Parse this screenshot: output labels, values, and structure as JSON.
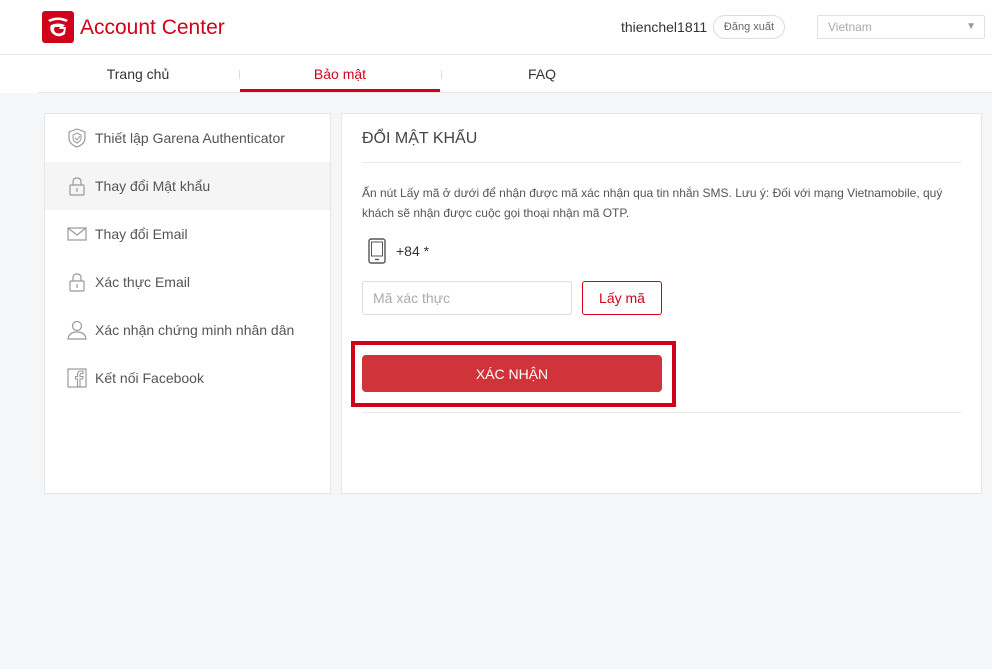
{
  "header": {
    "brand": "Account Center",
    "username": "thienchel1811",
    "logout_label": "Đăng xuất",
    "country": "Vietnam",
    "accent_color": "#d0021b"
  },
  "nav": {
    "tabs": [
      {
        "label": "Trang chủ",
        "active": false
      },
      {
        "label": "Bảo mật",
        "active": true
      },
      {
        "label": "FAQ",
        "active": false
      }
    ]
  },
  "sidebar": {
    "items": [
      {
        "label": "Thiết lập Garena Authenticator",
        "icon": "shield-icon",
        "active": false
      },
      {
        "label": "Thay đổi Mật khẩu",
        "icon": "lock-icon",
        "active": true
      },
      {
        "label": "Thay đổi Email",
        "icon": "envelope-icon",
        "active": false
      },
      {
        "label": "Xác thực Email",
        "icon": "lock-icon",
        "active": false
      },
      {
        "label": "Xác nhận chứng minh nhân dân",
        "icon": "user-icon",
        "active": false
      },
      {
        "label": "Kết nối Facebook",
        "icon": "facebook-icon",
        "active": false
      }
    ]
  },
  "main": {
    "title": "ĐỔI MẬT KHẨU",
    "description": "Ấn nút Lấy mã ở dưới để nhận được mã xác nhận qua tin nhắn SMS. Lưu ý: Đối với mạng Vietnamobile, quý khách sẽ nhận được cuộc gọi thoại nhận mã OTP.",
    "phone_code": "+84 *",
    "code_input": {
      "value": "",
      "placeholder": "Mã xác thực"
    },
    "get_code_label": "Lấy mã",
    "confirm_label": "XÁC NHẬN"
  }
}
